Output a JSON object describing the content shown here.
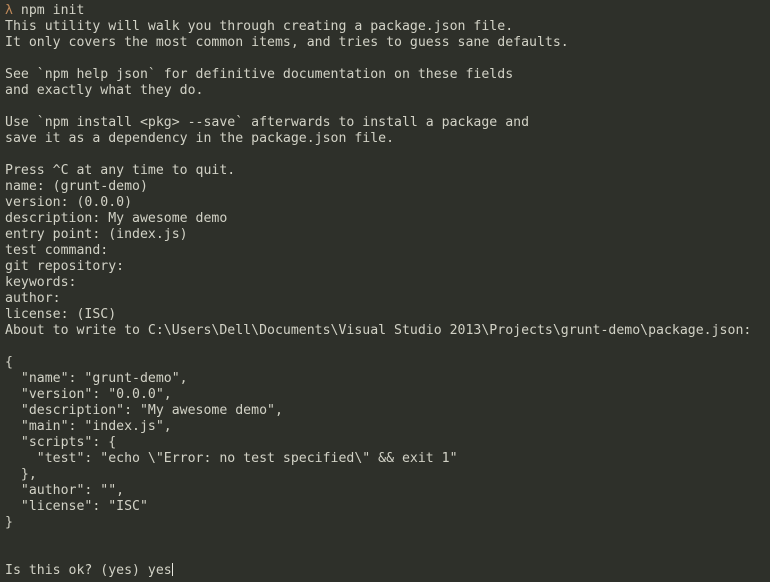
{
  "terminal": {
    "background_color": "#2e302a",
    "foreground_color": "#d2d2c6",
    "prompt_color": "#c08a5a",
    "prompt_symbol": "λ",
    "command": " npm init",
    "cursor_visible": true,
    "lines": [
      {
        "id": "intro-1",
        "text": "This utility will walk you through creating a package.json file."
      },
      {
        "id": "intro-2",
        "text": "It only covers the most common items, and tries to guess sane defaults."
      },
      {
        "id": "blank-1",
        "text": ""
      },
      {
        "id": "help-1",
        "text": "See `npm help json` for definitive documentation on these fields"
      },
      {
        "id": "help-2",
        "text": "and exactly what they do."
      },
      {
        "id": "blank-2",
        "text": ""
      },
      {
        "id": "install-1",
        "text": "Use `npm install <pkg> --save` afterwards to install a package and"
      },
      {
        "id": "install-2",
        "text": "save it as a dependency in the package.json file."
      },
      {
        "id": "blank-3",
        "text": ""
      },
      {
        "id": "quit-hint",
        "text": "Press ^C at any time to quit."
      },
      {
        "id": "prompt-name",
        "text": "name: (grunt-demo)"
      },
      {
        "id": "prompt-version",
        "text": "version: (0.0.0)"
      },
      {
        "id": "prompt-desc",
        "text": "description: My awesome demo"
      },
      {
        "id": "prompt-entry",
        "text": "entry point: (index.js)"
      },
      {
        "id": "prompt-test",
        "text": "test command:"
      },
      {
        "id": "prompt-git",
        "text": "git repository:"
      },
      {
        "id": "prompt-kw",
        "text": "keywords:"
      },
      {
        "id": "prompt-author",
        "text": "author:"
      },
      {
        "id": "prompt-license",
        "text": "license: (ISC)"
      },
      {
        "id": "about-write",
        "text": "About to write to C:\\Users\\Dell\\Documents\\Visual Studio 2013\\Projects\\grunt-demo\\package.json:"
      },
      {
        "id": "blank-4",
        "text": ""
      },
      {
        "id": "json-open",
        "text": "{"
      },
      {
        "id": "json-name",
        "text": "  \"name\": \"grunt-demo\","
      },
      {
        "id": "json-version",
        "text": "  \"version\": \"0.0.0\","
      },
      {
        "id": "json-desc",
        "text": "  \"description\": \"My awesome demo\","
      },
      {
        "id": "json-main",
        "text": "  \"main\": \"index.js\","
      },
      {
        "id": "json-scripts",
        "text": "  \"scripts\": {"
      },
      {
        "id": "json-test",
        "text": "    \"test\": \"echo \\\"Error: no test specified\\\" && exit 1\""
      },
      {
        "id": "json-scripts-c",
        "text": "  },"
      },
      {
        "id": "json-author",
        "text": "  \"author\": \"\","
      },
      {
        "id": "json-license",
        "text": "  \"license\": \"ISC\""
      },
      {
        "id": "json-close",
        "text": "}"
      },
      {
        "id": "blank-5",
        "text": ""
      },
      {
        "id": "blank-6",
        "text": ""
      }
    ],
    "confirm_prompt": "Is this ok? (yes) yes"
  }
}
